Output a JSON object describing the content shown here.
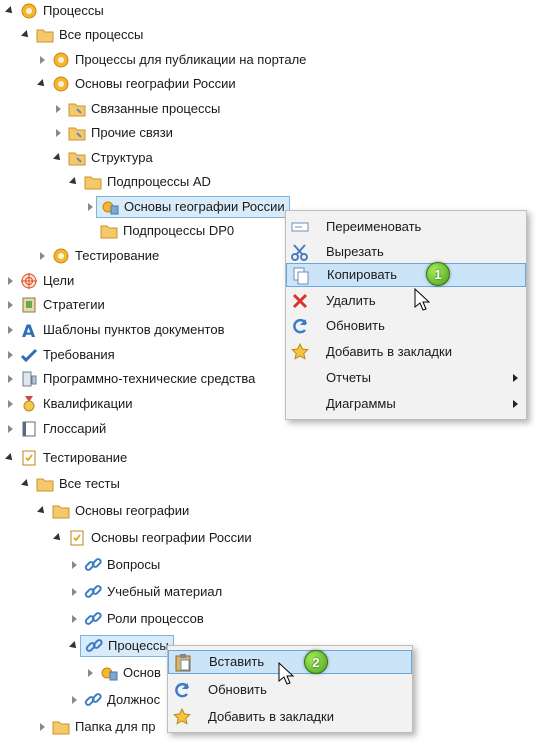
{
  "tree_top": [
    {
      "label": "Процессы",
      "icon": "gear-icon"
    },
    {
      "label": "Все процессы",
      "icon": "folder-icon"
    },
    {
      "label": "Процессы для публикации на портале",
      "icon": "gear-icon"
    },
    {
      "label": "Основы географии России",
      "icon": "gear-icon"
    },
    {
      "label": "Связанные процессы",
      "icon": "folder-link-icon"
    },
    {
      "label": "Прочие связи",
      "icon": "folder-link-icon"
    },
    {
      "label": "Структура",
      "icon": "folder-link-icon"
    },
    {
      "label": "Подпроцессы AD",
      "icon": "folder-icon"
    },
    {
      "label": "Основы географии России",
      "icon": "process-icon"
    },
    {
      "label": "Подпроцессы DP0",
      "icon": "folder-icon"
    },
    {
      "label": "Тестирование",
      "icon": "gear-icon"
    },
    {
      "label": "Цели",
      "icon": "target-icon"
    },
    {
      "label": "Стратегии",
      "icon": "strategy-icon"
    },
    {
      "label": "Шаблоны пунктов документов",
      "icon": "letter-a-icon"
    },
    {
      "label": "Требования",
      "icon": "checkmark-icon"
    },
    {
      "label": "Программно-технические средства",
      "icon": "computer-icon"
    },
    {
      "label": "Квалификации",
      "icon": "award-icon"
    },
    {
      "label": "Глоссарий",
      "icon": "book-icon"
    }
  ],
  "tree_bottom": [
    {
      "label": "Тестирование",
      "icon": "checklist-icon"
    },
    {
      "label": "Все тесты",
      "icon": "folder-icon"
    },
    {
      "label": "Основы географии",
      "icon": "folder-icon"
    },
    {
      "label": "Основы географии России",
      "icon": "checklist-icon"
    },
    {
      "label": "Вопросы",
      "icon": "link-icon"
    },
    {
      "label": "Учебный материал",
      "icon": "link-icon"
    },
    {
      "label": "Роли процессов",
      "icon": "link-icon"
    },
    {
      "label": "Процессы",
      "icon": "link-icon"
    },
    {
      "label": "Основ",
      "icon": "process-icon"
    },
    {
      "label": "Должнос",
      "icon": "link-icon"
    },
    {
      "label": "Папка для пр",
      "icon": "folder-icon"
    }
  ],
  "menu1": {
    "items": [
      {
        "label": "Переименовать",
        "icon": "rename-icon"
      },
      {
        "label": "Вырезать",
        "icon": "scissors-icon"
      },
      {
        "label": "Копировать",
        "icon": "copy-icon"
      },
      {
        "label": "Удалить",
        "icon": "delete-icon"
      },
      {
        "label": "Обновить",
        "icon": "refresh-icon"
      },
      {
        "label": "Добавить в закладки",
        "icon": "bookmark-star-icon"
      },
      {
        "label": "Отчеты",
        "icon": ""
      },
      {
        "label": "Диаграммы",
        "icon": ""
      }
    ],
    "badge": "1"
  },
  "menu2": {
    "items": [
      {
        "label": "Вставить",
        "icon": "paste-icon"
      },
      {
        "label": "Обновить",
        "icon": "refresh-icon"
      },
      {
        "label": "Добавить в закладки",
        "icon": "bookmark-star-icon"
      }
    ],
    "badge": "2"
  },
  "colors": {
    "selection": "#d9ebf9",
    "menu_bg": "#f2f2f2",
    "menu_highlight": "#cce4f7",
    "badge": "#4aa11d"
  }
}
